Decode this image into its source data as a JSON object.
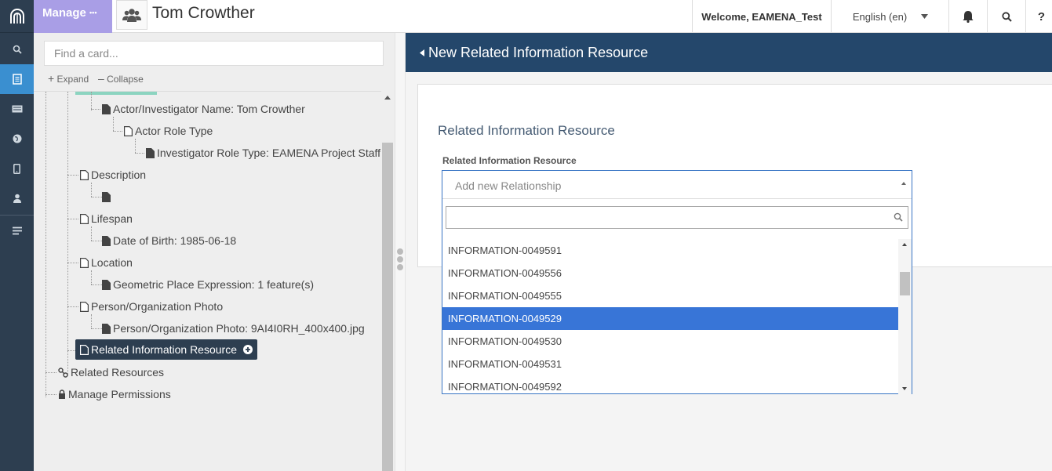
{
  "topbar": {
    "manage_label": "Manage",
    "manage_more": "•••",
    "resource_title": "Tom Crowther",
    "welcome": "Welcome, EAMENA_Test",
    "language": "English (en)",
    "help": "?"
  },
  "sidebar_icons": [
    "search-icon",
    "resource-editor-icon",
    "card-icon",
    "globe-icon",
    "mobile-icon",
    "user-icon",
    "list-icon"
  ],
  "left_panel": {
    "search_placeholder": "Find a card...",
    "expand_label": "Expand",
    "collapse_label": "Collapse",
    "tree": [
      "Actor/Investigator Name: Tom Crowther",
      "Actor Role Type",
      "Investigator Role Type: EAMENA Project Staff",
      "Description",
      "",
      "Lifespan",
      "Date of Birth: 1985-06-18",
      "Location",
      "Geometric Place Expression: 1 feature(s)",
      "Person/Organization Photo",
      "Person/Organization Photo: 9AI4I0RH_400x400.jpg",
      "Related Information Resource",
      "Related Resources",
      "Manage Permissions"
    ]
  },
  "right_panel": {
    "header": "New Related Information Resource",
    "card_title": "Related Information Resource",
    "field_label": "Related Information Resource",
    "select_placeholder": "Add new Relationship",
    "options": [
      "INFORMATION-0049591",
      "INFORMATION-0049556",
      "INFORMATION-0049555",
      "INFORMATION-0049529",
      "INFORMATION-0049530",
      "INFORMATION-0049531",
      "INFORMATION-0049592"
    ],
    "highlighted_option": "INFORMATION-0049529"
  },
  "colors": {
    "rail": "#2d3e50",
    "rail_active": "#3a8fd0",
    "manage": "#a99ee6",
    "header": "#24476b",
    "highlight": "#3875d7"
  }
}
